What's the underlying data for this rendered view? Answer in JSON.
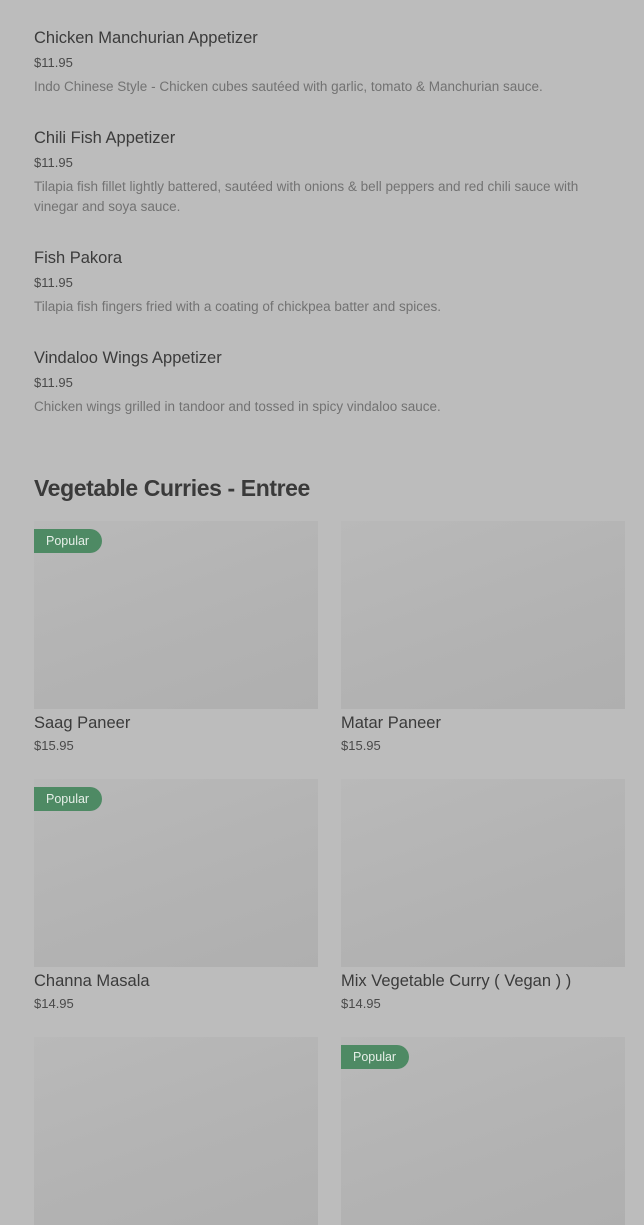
{
  "menu_items": [
    {
      "name": "Chicken Manchurian Appetizer",
      "price": "$11.95",
      "description": "Indo Chinese Style - Chicken cubes sautéed with garlic, tomato & Manchurian sauce."
    },
    {
      "name": "Chili Fish Appetizer",
      "price": "$11.95",
      "description": "Tilapia fish fillet lightly battered, sautéed with onions & bell peppers and red chili sauce with vinegar and soya sauce."
    },
    {
      "name": "Fish Pakora",
      "price": "$11.95",
      "description": "Tilapia fish fingers fried with a coating of chickpea batter and spices."
    },
    {
      "name": "Vindaloo Wings Appetizer",
      "price": "$11.95",
      "description": "Chicken wings grilled in tandoor and tossed in spicy vindaloo sauce."
    }
  ],
  "section": {
    "title": "Vegetable Curries - Entree",
    "badge_label": "Popular",
    "cards": [
      {
        "name": "Saag Paneer",
        "price": "$15.95",
        "popular": true,
        "badge": "Popular"
      },
      {
        "name": "Matar Paneer",
        "price": "$15.95",
        "popular": false,
        "badge": ""
      },
      {
        "name": "Channa Masala",
        "price": "$14.95",
        "popular": true,
        "badge": "Popular"
      },
      {
        "name": "Mix Vegetable Curry ( Vegan ) )",
        "price": "$14.95",
        "popular": false,
        "badge": ""
      },
      {
        "name": "",
        "price": "",
        "popular": false,
        "badge": ""
      },
      {
        "name": "",
        "price": "",
        "popular": true,
        "badge": "Popular"
      }
    ]
  },
  "colors": {
    "background": "#bcbcbc",
    "badge": "#4e8a64",
    "text": "#3a3a3a",
    "muted_text": "#727272"
  }
}
